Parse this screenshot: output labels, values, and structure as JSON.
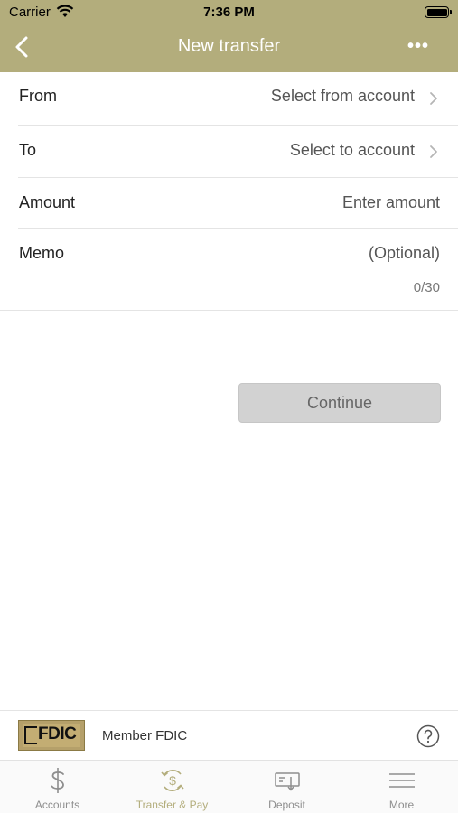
{
  "status_bar": {
    "carrier": "Carrier",
    "time": "7:36 PM"
  },
  "nav": {
    "title": "New transfer",
    "more_label": "•••"
  },
  "form": {
    "from": {
      "label": "From",
      "value": "Select from account"
    },
    "to": {
      "label": "To",
      "value": "Select to account"
    },
    "amount": {
      "label": "Amount",
      "placeholder": "Enter amount"
    },
    "memo": {
      "label": "Memo",
      "placeholder": "(Optional)",
      "counter": "0/30"
    }
  },
  "continue_label": "Continue",
  "footer": {
    "fdic_logo_text": "FDIC",
    "member_text": "Member FDIC"
  },
  "tabs": [
    {
      "label": "Accounts",
      "icon": "dollar-icon",
      "active": false
    },
    {
      "label": "Transfer & Pay",
      "icon": "transfer-dollar-icon",
      "active": true
    },
    {
      "label": "Deposit",
      "icon": "check-deposit-icon",
      "active": false
    },
    {
      "label": "More",
      "icon": "menu-icon",
      "active": false
    }
  ],
  "colors": {
    "brand": "#b3ad7c",
    "button_disabled": "#d2d2d2"
  }
}
